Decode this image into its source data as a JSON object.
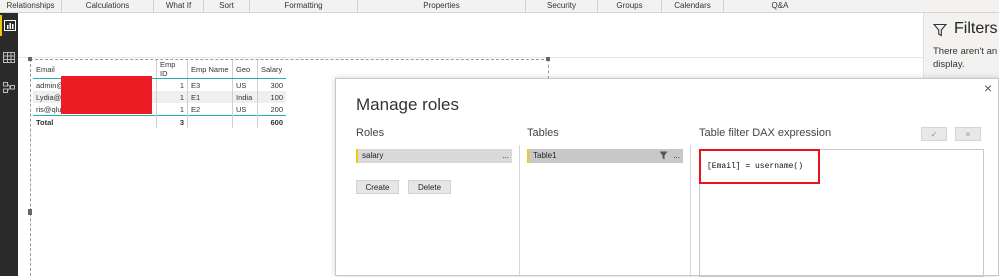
{
  "ribbon": {
    "groups": [
      "Relationships",
      "Calculations",
      "What If",
      "Sort",
      "Formatting",
      "Properties",
      "Security",
      "Groups",
      "Calendars",
      "Q&A"
    ]
  },
  "table_visual": {
    "headers": [
      "Email",
      "Emp ID",
      "Emp Name",
      "Geo",
      "Salary"
    ],
    "rows": [
      {
        "email": "admin@",
        "emp_id": "1",
        "emp_name": "E3",
        "geo": "US",
        "salary": "300"
      },
      {
        "email": "Lydia@",
        "emp_id": "1",
        "emp_name": "E1",
        "geo": "India",
        "salary": "100"
      },
      {
        "email": "ris@qlu",
        "emp_id": "1",
        "emp_name": "E2",
        "geo": "US",
        "salary": "200"
      }
    ],
    "total": {
      "label": "Total",
      "emp_id": "3",
      "salary": "600"
    }
  },
  "filters": {
    "title": "Filters",
    "message_line1": "There aren't an",
    "message_line2": "display."
  },
  "dialog": {
    "title": "Manage roles",
    "close_glyph": "×",
    "roles_header": "Roles",
    "tables_header": "Tables",
    "dax_header": "Table filter DAX expression",
    "role_name": "salary",
    "role_menu": "...",
    "create_label": "Create",
    "delete_label": "Delete",
    "table_name": "Table1",
    "table_menu": "...",
    "dax_expression": "[Email] = username()",
    "confirm_glyph": "✓",
    "cancel_glyph": "×"
  },
  "colors": {
    "highlight_red": "#e8141d",
    "redaction_red": "#ed1c24",
    "accent_teal": "#20b2aa",
    "role_marker_yellow": "#f2c811",
    "rail_dark": "#2b2b2b"
  }
}
